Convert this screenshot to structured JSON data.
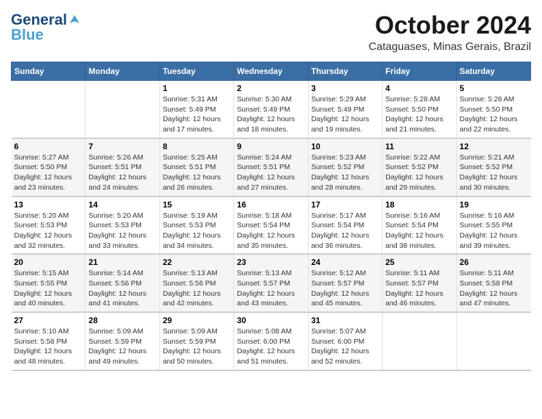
{
  "header": {
    "logo_line1": "General",
    "logo_line2": "Blue",
    "month": "October 2024",
    "location": "Cataguases, Minas Gerais, Brazil"
  },
  "days_of_week": [
    "Sunday",
    "Monday",
    "Tuesday",
    "Wednesday",
    "Thursday",
    "Friday",
    "Saturday"
  ],
  "weeks": [
    [
      {
        "day": "",
        "info": ""
      },
      {
        "day": "",
        "info": ""
      },
      {
        "day": "1",
        "info": "Sunrise: 5:31 AM\nSunset: 5:49 PM\nDaylight: 12 hours\nand 17 minutes."
      },
      {
        "day": "2",
        "info": "Sunrise: 5:30 AM\nSunset: 5:49 PM\nDaylight: 12 hours\nand 18 minutes."
      },
      {
        "day": "3",
        "info": "Sunrise: 5:29 AM\nSunset: 5:49 PM\nDaylight: 12 hours\nand 19 minutes."
      },
      {
        "day": "4",
        "info": "Sunrise: 5:28 AM\nSunset: 5:50 PM\nDaylight: 12 hours\nand 21 minutes."
      },
      {
        "day": "5",
        "info": "Sunrise: 5:28 AM\nSunset: 5:50 PM\nDaylight: 12 hours\nand 22 minutes."
      }
    ],
    [
      {
        "day": "6",
        "info": "Sunrise: 5:27 AM\nSunset: 5:50 PM\nDaylight: 12 hours\nand 23 minutes."
      },
      {
        "day": "7",
        "info": "Sunrise: 5:26 AM\nSunset: 5:51 PM\nDaylight: 12 hours\nand 24 minutes."
      },
      {
        "day": "8",
        "info": "Sunrise: 5:25 AM\nSunset: 5:51 PM\nDaylight: 12 hours\nand 26 minutes."
      },
      {
        "day": "9",
        "info": "Sunrise: 5:24 AM\nSunset: 5:51 PM\nDaylight: 12 hours\nand 27 minutes."
      },
      {
        "day": "10",
        "info": "Sunrise: 5:23 AM\nSunset: 5:52 PM\nDaylight: 12 hours\nand 28 minutes."
      },
      {
        "day": "11",
        "info": "Sunrise: 5:22 AM\nSunset: 5:52 PM\nDaylight: 12 hours\nand 29 minutes."
      },
      {
        "day": "12",
        "info": "Sunrise: 5:21 AM\nSunset: 5:52 PM\nDaylight: 12 hours\nand 30 minutes."
      }
    ],
    [
      {
        "day": "13",
        "info": "Sunrise: 5:20 AM\nSunset: 5:53 PM\nDaylight: 12 hours\nand 32 minutes."
      },
      {
        "day": "14",
        "info": "Sunrise: 5:20 AM\nSunset: 5:53 PM\nDaylight: 12 hours\nand 33 minutes."
      },
      {
        "day": "15",
        "info": "Sunrise: 5:19 AM\nSunset: 5:53 PM\nDaylight: 12 hours\nand 34 minutes."
      },
      {
        "day": "16",
        "info": "Sunrise: 5:18 AM\nSunset: 5:54 PM\nDaylight: 12 hours\nand 35 minutes."
      },
      {
        "day": "17",
        "info": "Sunrise: 5:17 AM\nSunset: 5:54 PM\nDaylight: 12 hours\nand 36 minutes."
      },
      {
        "day": "18",
        "info": "Sunrise: 5:16 AM\nSunset: 5:54 PM\nDaylight: 12 hours\nand 38 minutes."
      },
      {
        "day": "19",
        "info": "Sunrise: 5:16 AM\nSunset: 5:55 PM\nDaylight: 12 hours\nand 39 minutes."
      }
    ],
    [
      {
        "day": "20",
        "info": "Sunrise: 5:15 AM\nSunset: 5:55 PM\nDaylight: 12 hours\nand 40 minutes."
      },
      {
        "day": "21",
        "info": "Sunrise: 5:14 AM\nSunset: 5:56 PM\nDaylight: 12 hours\nand 41 minutes."
      },
      {
        "day": "22",
        "info": "Sunrise: 5:13 AM\nSunset: 5:56 PM\nDaylight: 12 hours\nand 42 minutes."
      },
      {
        "day": "23",
        "info": "Sunrise: 5:13 AM\nSunset: 5:57 PM\nDaylight: 12 hours\nand 43 minutes."
      },
      {
        "day": "24",
        "info": "Sunrise: 5:12 AM\nSunset: 5:57 PM\nDaylight: 12 hours\nand 45 minutes."
      },
      {
        "day": "25",
        "info": "Sunrise: 5:11 AM\nSunset: 5:57 PM\nDaylight: 12 hours\nand 46 minutes."
      },
      {
        "day": "26",
        "info": "Sunrise: 5:11 AM\nSunset: 5:58 PM\nDaylight: 12 hours\nand 47 minutes."
      }
    ],
    [
      {
        "day": "27",
        "info": "Sunrise: 5:10 AM\nSunset: 5:58 PM\nDaylight: 12 hours\nand 48 minutes."
      },
      {
        "day": "28",
        "info": "Sunrise: 5:09 AM\nSunset: 5:59 PM\nDaylight: 12 hours\nand 49 minutes."
      },
      {
        "day": "29",
        "info": "Sunrise: 5:09 AM\nSunset: 5:59 PM\nDaylight: 12 hours\nand 50 minutes."
      },
      {
        "day": "30",
        "info": "Sunrise: 5:08 AM\nSunset: 6:00 PM\nDaylight: 12 hours\nand 51 minutes."
      },
      {
        "day": "31",
        "info": "Sunrise: 5:07 AM\nSunset: 6:00 PM\nDaylight: 12 hours\nand 52 minutes."
      },
      {
        "day": "",
        "info": ""
      },
      {
        "day": "",
        "info": ""
      }
    ]
  ]
}
